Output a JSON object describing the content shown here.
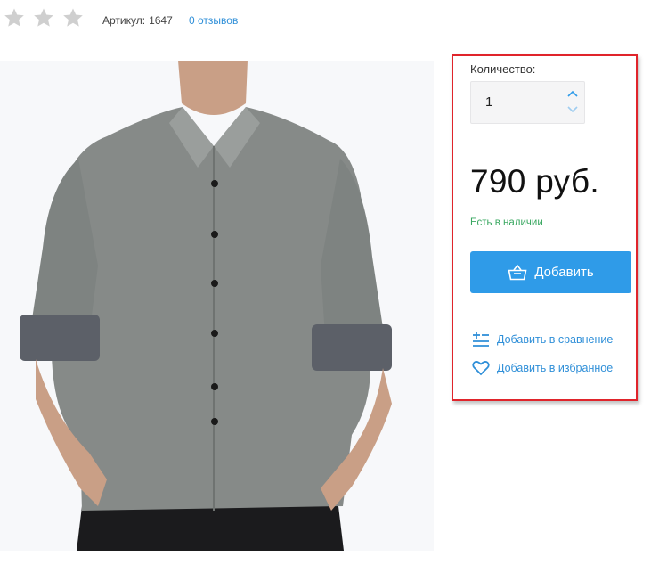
{
  "rating": {
    "stars_filled": 0,
    "stars_total": 3
  },
  "article": {
    "label": "Артикул:",
    "value": "1647"
  },
  "reviews": {
    "label": "0 отзывов"
  },
  "panel": {
    "quantity_label": "Количество:",
    "quantity_value": "1",
    "price": "790 руб.",
    "stock": "Есть в наличии",
    "add_button": "Добавить",
    "compare_link": "Добавить в сравнение",
    "favorite_link": "Добавить в избранное"
  },
  "colors": {
    "accent": "#2f9be8",
    "link": "#2f8fd8",
    "in_stock": "#3aa861",
    "highlight": "#e0242b"
  },
  "icons": [
    "star-icon",
    "chevron-up-icon",
    "chevron-down-icon",
    "basket-icon",
    "compare-icon",
    "heart-icon"
  ]
}
